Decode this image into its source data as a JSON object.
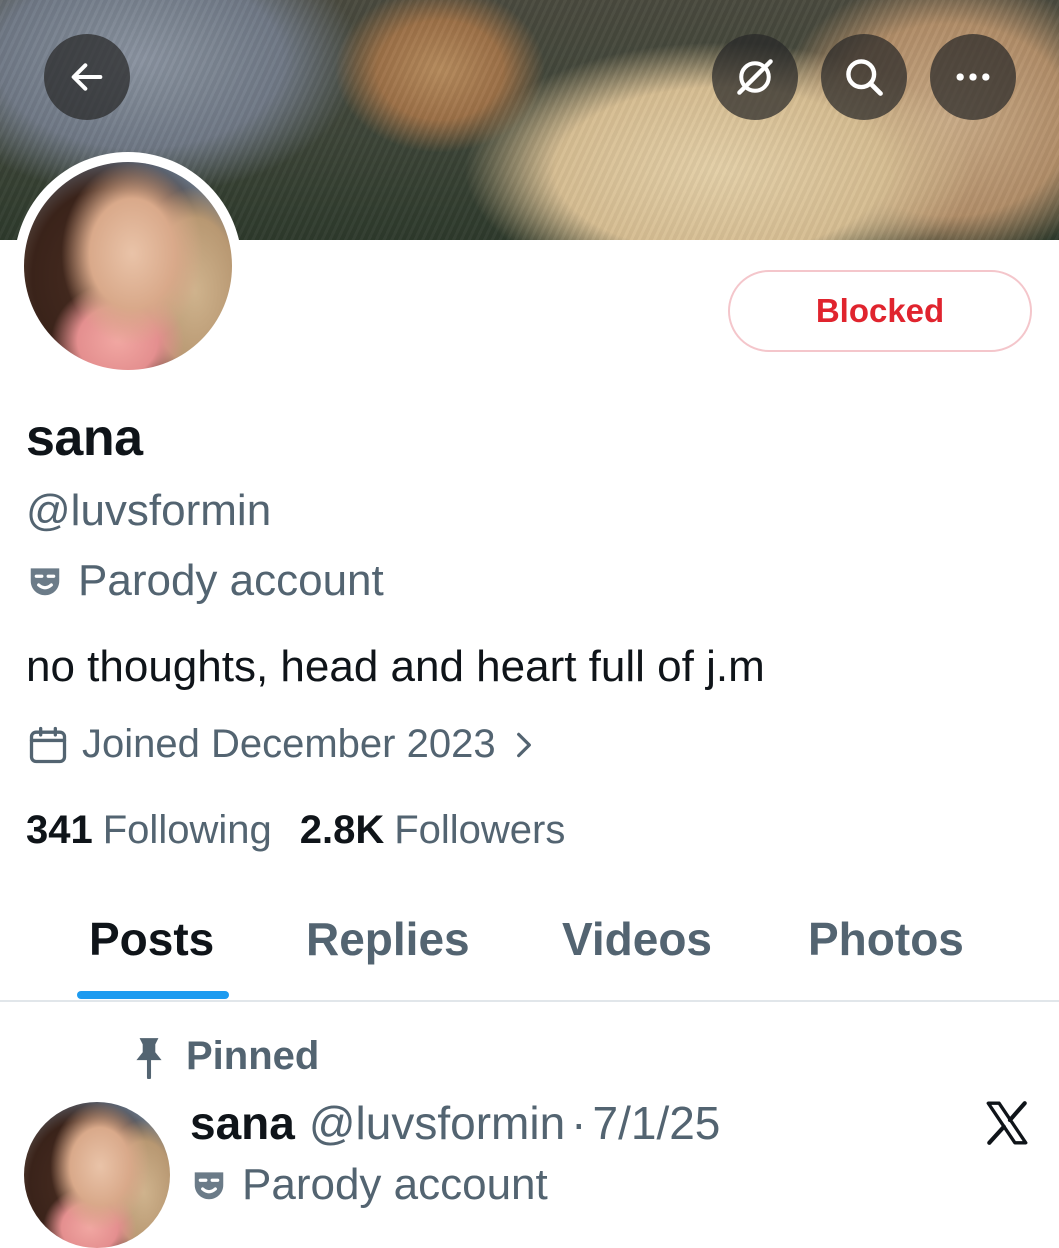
{
  "header": {
    "back_icon": "arrow-left-icon",
    "grok_icon": "grok-icon",
    "search_icon": "search-icon",
    "more_icon": "more-horizontal-icon"
  },
  "profile": {
    "name": "sana",
    "handle": "@luvsformin",
    "label_icon": "parody-mask-icon",
    "label": "Parody account",
    "bio": "no thoughts, head and heart full of j.m",
    "joined": "Joined December 2023",
    "following_count": "341",
    "following_label": "Following",
    "followers_count": "2.8K",
    "followers_label": "Followers",
    "block_button": "Blocked"
  },
  "tabs": [
    "Posts",
    "Replies",
    "Videos",
    "Photos"
  ],
  "active_tab": "Posts",
  "pinned_post": {
    "pinned_label": "Pinned",
    "author_name": "sana",
    "author_handle": "@luvsformin",
    "date_sep": "·",
    "date": "7/1/25",
    "author_label": "Parody account"
  },
  "colors": {
    "blocked_text": "#e0242e",
    "blocked_border": "#f4c6cb",
    "tab_indicator": "#1d9bf0",
    "secondary_text": "#536471",
    "primary_text": "#0f1419"
  }
}
